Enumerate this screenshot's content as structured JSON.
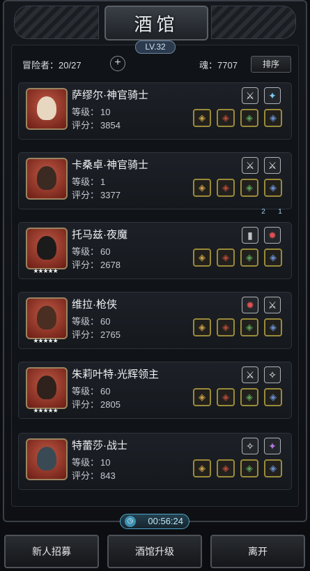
{
  "header": {
    "title": "酒馆",
    "level": "LV.32"
  },
  "info": {
    "adventurer_label": "冒险者：",
    "adventurer_count": "20/27",
    "add_icon": "plus-icon",
    "soul_label": "魂：",
    "soul_value": "7707",
    "sort_label": "排序"
  },
  "labels": {
    "level": "等级：",
    "score": "评分："
  },
  "heroes": [
    {
      "name": "萨缪尔·神官骑士",
      "level": "10",
      "score": "3854",
      "stars": "",
      "skills": [
        "sword-skill-icon",
        "blue-skill-icon"
      ],
      "equip_colors": [
        "#9a8a3a",
        "#9a8a3a",
        "#9a8a3a",
        "#9a8a3a"
      ]
    },
    {
      "name": "卡桑卓·神官骑士",
      "level": "1",
      "score": "3377",
      "stars": "",
      "skills": [
        "sword-skill-icon",
        "sword-skill-icon"
      ],
      "equip_colors": [
        "#9a8a3a",
        "#9a8a3a",
        "#9a8a3a",
        "#9a8a3a"
      ]
    },
    {
      "name": "托马兹·夜魔",
      "level": "60",
      "score": "2678",
      "stars": "★★★★★",
      "skills": [
        "gray-skill-icon",
        "red-skill-icon"
      ],
      "equip_colors": [
        "#9a8a3a",
        "#9a8a3a",
        "#9a8a3a",
        "#9a8a3a"
      ]
    },
    {
      "name": "维拉·枪侠",
      "level": "60",
      "score": "2765",
      "stars": "★★★★★",
      "skills": [
        "red-skill-icon",
        "sword-skill-icon"
      ],
      "equip_colors": [
        "#9a8a3a",
        "#9a8a3a",
        "#9a8a3a",
        "#9a8a3a"
      ]
    },
    {
      "name": "朱莉叶特·光辉领主",
      "level": "60",
      "score": "2805",
      "stars": "★★★★★",
      "skills": [
        "sword-skill-icon",
        "white-skill-icon"
      ],
      "equip_colors": [
        "#9a8a3a",
        "#9a8a3a",
        "#9a8a3a",
        "#9a8a3a"
      ]
    },
    {
      "name": "特蕾莎·战士",
      "level": "10",
      "score": "843",
      "stars": "",
      "skills": [
        "white-skill-icon",
        "purple-skill-icon"
      ],
      "equip_colors": [
        "#9a8a3a",
        "#9a8a3a",
        "#9a8a3a",
        "#9a8a3a"
      ]
    }
  ],
  "bookmarks": [
    "2",
    "1"
  ],
  "timer": "00:56:24",
  "buttons": {
    "recruit": "新人招募",
    "upgrade": "酒馆升级",
    "leave": "离开"
  }
}
